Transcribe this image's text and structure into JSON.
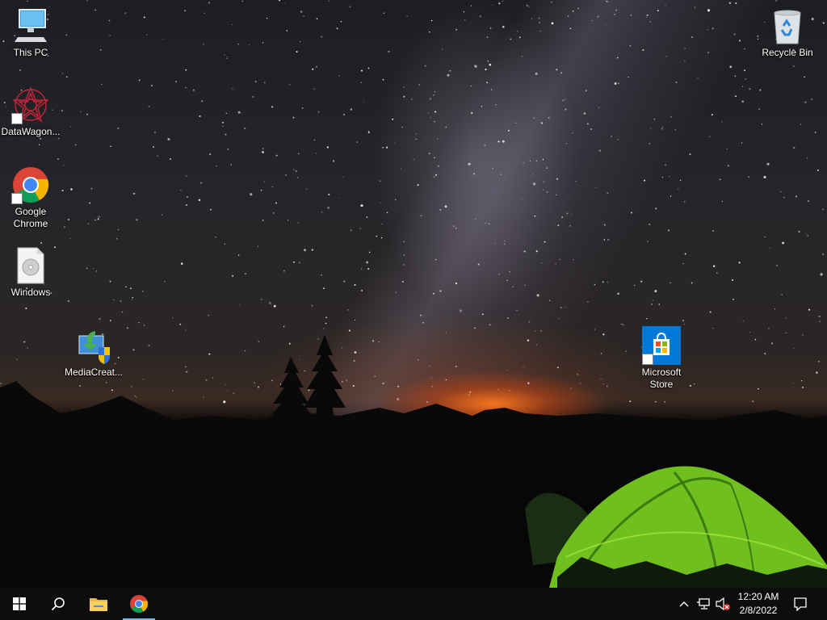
{
  "desktop": {
    "icons": [
      {
        "label": "This PC",
        "icon": "monitor-icon"
      },
      {
        "label": "DataWagon...",
        "icon": "datawagon-app-icon"
      },
      {
        "label": "Google Chrome",
        "icon": "chrome-icon"
      },
      {
        "label": "Windows",
        "icon": "disc-image-file-icon"
      },
      {
        "label": "MediaCreat...",
        "icon": "media-creation-tool-icon"
      },
      {
        "label": "Microsoft Store",
        "icon": "microsoft-store-icon"
      },
      {
        "label": "Recycle Bin",
        "icon": "recycle-bin-icon"
      }
    ]
  },
  "taskbar": {
    "start": "windows-start-icon",
    "search": "search-icon",
    "pinned": [
      {
        "name": "File Explorer",
        "icon": "folder-icon"
      },
      {
        "name": "Google Chrome",
        "icon": "chrome-icon",
        "active": true
      }
    ],
    "tray": {
      "chevron": "chevron-up-icon",
      "network": "network-icon",
      "volume": "volume-muted-icon",
      "notifications": "action-center-icon"
    },
    "clock": {
      "time": "12:20 AM",
      "date": "2/8/2022"
    }
  },
  "colors": {
    "taskbar_bg": "#0d0d10",
    "active_indicator": "#76b9ed",
    "tent_green": "#7ed321",
    "horizon_glow": "#ff7a1e"
  }
}
